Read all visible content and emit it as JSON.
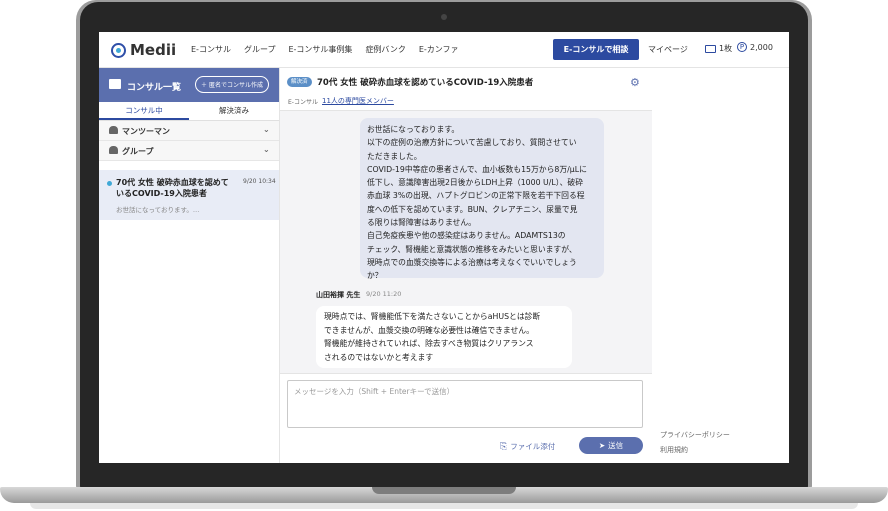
{
  "header": {
    "logo": "Medii",
    "nav": [
      "E-コンサル",
      "グループ",
      "E-コンサル事例集",
      "症例バンク",
      "E-カンファ"
    ],
    "cta": "E-コンサルで相談",
    "mypage": "マイページ",
    "tickets": "1枚",
    "points_icon": "P",
    "points": "2,000"
  },
  "sidebar": {
    "title": "コンサル一覧",
    "new_button": "匿名でコンサル作成",
    "tabs": [
      "コンサル中",
      "解決済み"
    ],
    "groups": [
      "マンツーマン",
      "グループ"
    ],
    "item": {
      "title": "70代 女性 破砕赤血球を認めているCOVID-19入院患者",
      "time": "9/20 10:34",
      "preview": "お世話になっております。…"
    }
  },
  "main": {
    "badge": "解決済",
    "title": "70代 女性 破砕赤血球を認めているCOVID-19入院患者",
    "subtype": "E-コンサル",
    "members": "11人の専門医メンバー",
    "messages": {
      "mine": [
        "お世話になっております。",
        "以下の症例の治療方針について苦慮しており、質問させてい",
        "ただきました。",
        "COVID-19中等症の患者さんで、血小板数も15万から8万/μLに",
        "低下し、意識障害出現2日後からLDH上昇（1000 U/L）、破砕",
        "赤血球 3%の出現、ハプトグロビンの正常下限を若干下回る程",
        "度への低下を認めています。BUN、クレアチニン、尿量で見",
        "る限りは腎障害はありません。",
        "自己免疫疾患や他の感染症はありません。ADAMTS13の",
        "チェック、腎機能と意識状態の推移をみたいと思いますが、",
        "現時点での血漿交換等による治療は考えなくでいいでしょう",
        "か？"
      ],
      "reply_sender": "山田裕揮 先生",
      "reply_time": "9/20  11:20",
      "reply": [
        "現時点では、腎機能低下を満たさないことからaHUSとは診断",
        "できませんが、血漿交換の明確な必要性は確信できません。",
        "腎機能が維持されていれば、除去すべき物質はクリアランス",
        "されるのではないかと考えます"
      ]
    },
    "composer": {
      "placeholder": "メッセージを入力（Shift + Enterキーで送信）",
      "attach": "ファイル添付",
      "send": "送信"
    }
  },
  "right": {
    "links": [
      "プライバシーポリシー",
      "利用規約"
    ]
  },
  "colors": {
    "brand": "#2c4aa0",
    "sidebar_header": "#5b6fae",
    "bubble": "#e3e6f1"
  }
}
